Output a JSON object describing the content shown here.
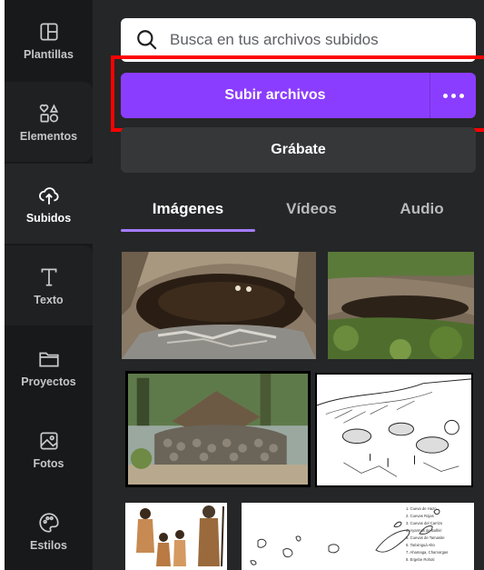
{
  "sidebar": {
    "items": [
      {
        "label": "Plantillas",
        "icon": "templates-icon"
      },
      {
        "label": "Elementos",
        "icon": "elements-icon"
      },
      {
        "label": "Subidos",
        "icon": "upload-cloud-icon"
      },
      {
        "label": "Texto",
        "icon": "text-icon"
      },
      {
        "label": "Proyectos",
        "icon": "folder-icon"
      },
      {
        "label": "Fotos",
        "icon": "image-icon"
      },
      {
        "label": "Estilos",
        "icon": "palette-icon"
      }
    ],
    "active_index": 2
  },
  "search": {
    "placeholder": "Busca en tus archivos subidos",
    "value": "",
    "icon": "search-icon"
  },
  "actions": {
    "upload_label": "Subir archivos",
    "more_icon": "more-dots-icon",
    "record_label": "Grábate"
  },
  "tabs": [
    {
      "label": "Imágenes",
      "active": true
    },
    {
      "label": "Vídeos",
      "active": false
    },
    {
      "label": "Audio",
      "active": false
    }
  ],
  "map_legend": [
    "1. Cueva de Hazo",
    "2. Cuevas Rojas",
    "3. Cuevas del Carrizo",
    "4. Ayarmas de Balhiri",
    "5. Cuevas de Tamasite",
    "6. Tarixinguá Alto",
    "7. Ahamaga, Chamorgas",
    "8. Ergebe Rohoti"
  ],
  "colors": {
    "accent": "#8b3dff",
    "panel": "#252627",
    "rail": "#18191b",
    "highlight": "#ff0000"
  }
}
